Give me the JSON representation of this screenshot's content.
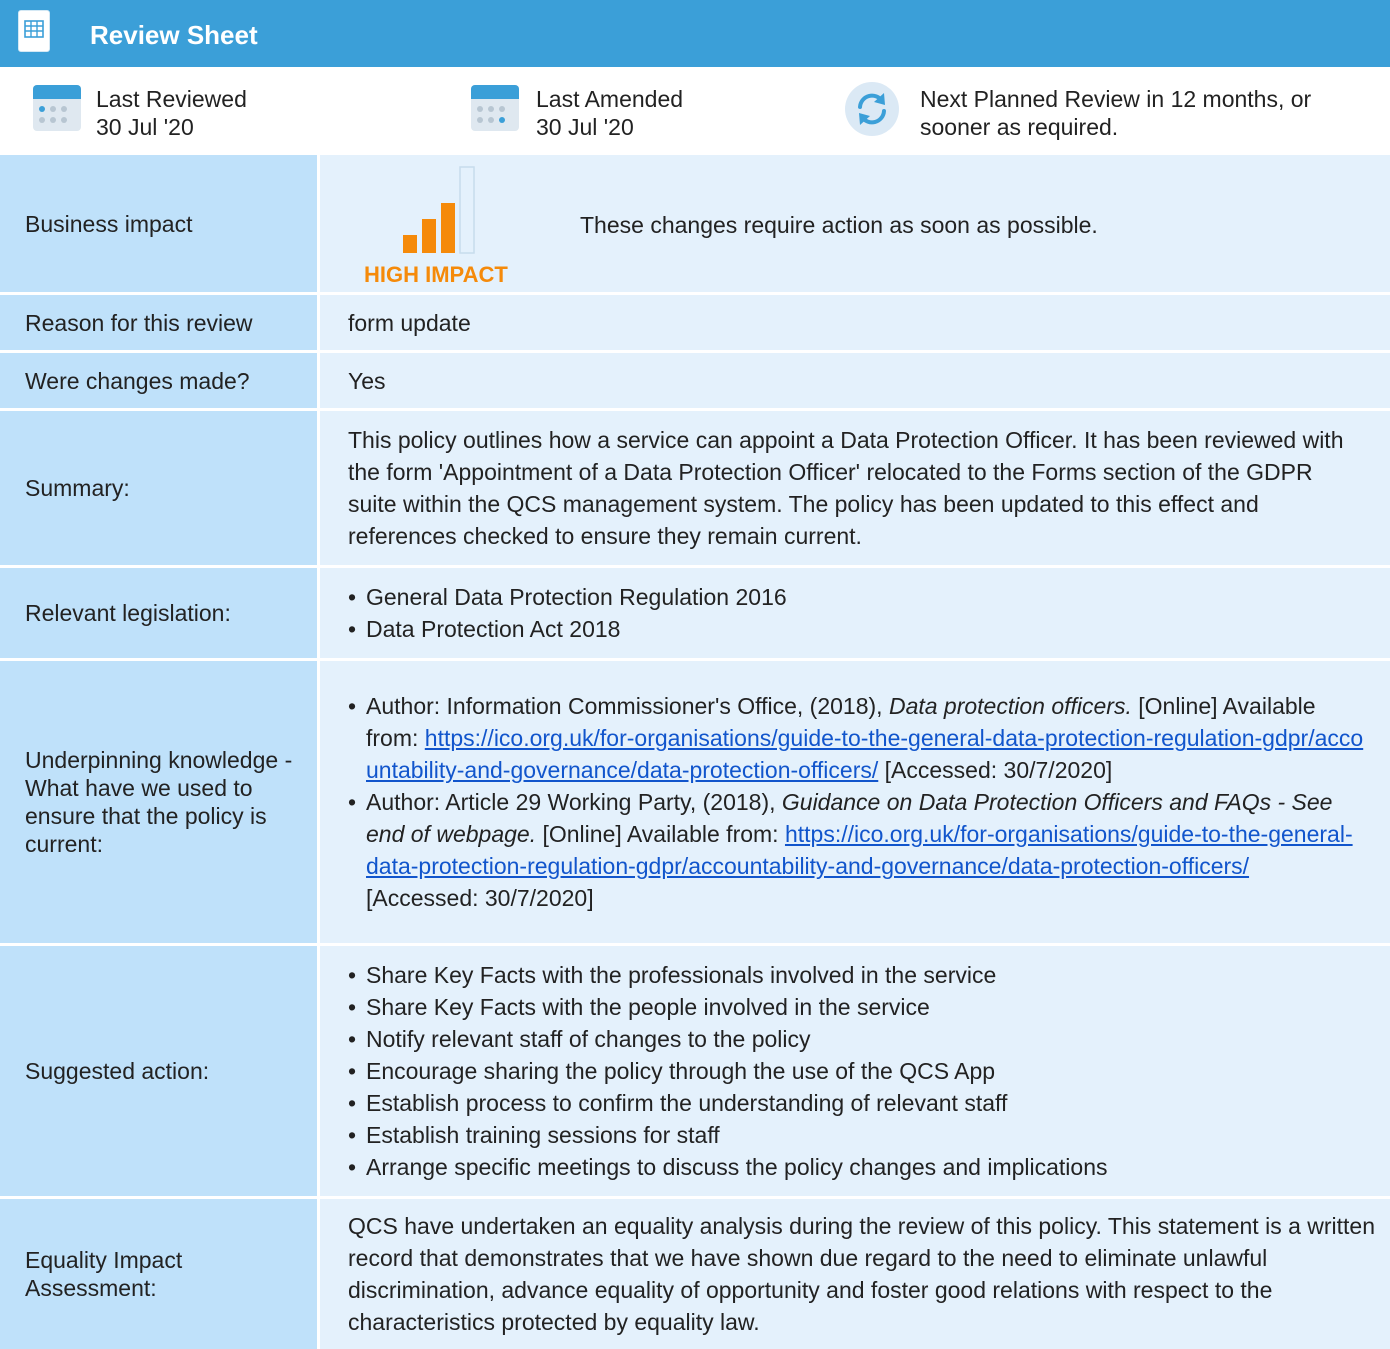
{
  "header": {
    "title": "Review Sheet",
    "icon": "document-icon"
  },
  "meta": {
    "last_reviewed_label": "Last Reviewed",
    "last_reviewed_date": "30 Jul '20",
    "last_amended_label": "Last Amended",
    "last_amended_date": "30 Jul '20",
    "next_review_line1": "Next Planned Review in 12 months, or",
    "next_review_line2": "sooner as required."
  },
  "business_impact": {
    "label": "Business impact",
    "badge": "HIGH IMPACT",
    "text": "These changes require action as soon as possible.",
    "level_bars_filled": 3,
    "level_bars_total": 4
  },
  "reason": {
    "label": "Reason for this review",
    "value": "form update"
  },
  "changes": {
    "label": "Were changes made?",
    "value": "Yes"
  },
  "summary": {
    "label": "Summary:",
    "text": "This policy outlines how a service can appoint a Data Protection Officer. It has been reviewed with the form 'Appointment of a Data Protection Officer' relocated to the Forms section of the GDPR suite within the QCS management system. The policy has been updated to this effect and references checked to ensure they remain current."
  },
  "legislation": {
    "label": "Relevant legislation:",
    "items": [
      "General Data Protection Regulation 2016",
      "Data Protection Act 2018"
    ]
  },
  "underpinning": {
    "label": "Underpinning knowledge - What have we used to ensure that the policy is current:",
    "ref1_prefix": "Author: Information Commissioner's Office, (2018), ",
    "ref1_title": "Data protection officers.",
    "ref1_mid": " [Online] Available from: ",
    "ref1_link": "https://ico.org.uk/for-organisations/guide-to-the-general-data-protection-regulation-gdpr/accountability-and-governance/data-protection-officers/",
    "ref1_suffix": " [Accessed: 30/7/2020]",
    "ref2_prefix": "Author: Article 29 Working Party, (2018), ",
    "ref2_title": "Guidance on Data Protection Officers and FAQs - See end of webpage.",
    "ref2_mid": " [Online] Available from: ",
    "ref2_link": "https://ico.org.uk/for-organisations/guide-to-the-general-data-protection-regulation-gdpr/accountability-and-governance/data-protection-officers/",
    "ref2_suffix": " [Accessed: 30/7/2020]"
  },
  "suggested": {
    "label": "Suggested action:",
    "items": [
      "Share Key Facts with the professionals involved in the service",
      "Share Key Facts with the people involved in the service",
      "Notify relevant staff of changes to the policy",
      "Encourage sharing the policy through the use of the QCS App",
      "Establish process to confirm the understanding of relevant staff",
      "Establish training sessions for staff",
      "Arrange specific meetings to discuss the policy changes and implications"
    ]
  },
  "equality": {
    "label": "Equality Impact Assessment:",
    "text": "QCS have undertaken an equality analysis during the review of this policy. This statement is a written record that demonstrates that we have shown due regard to the need to eliminate unlawful discrimination, advance equality of opportunity and foster good relations with respect to the characteristics protected by equality law."
  },
  "colors": {
    "header_bg": "#3b9fd8",
    "label_bg": "#bfe1fa",
    "value_bg": "#e4f1fc",
    "impact_orange": "#f58a0a",
    "link": "#1155cc"
  }
}
